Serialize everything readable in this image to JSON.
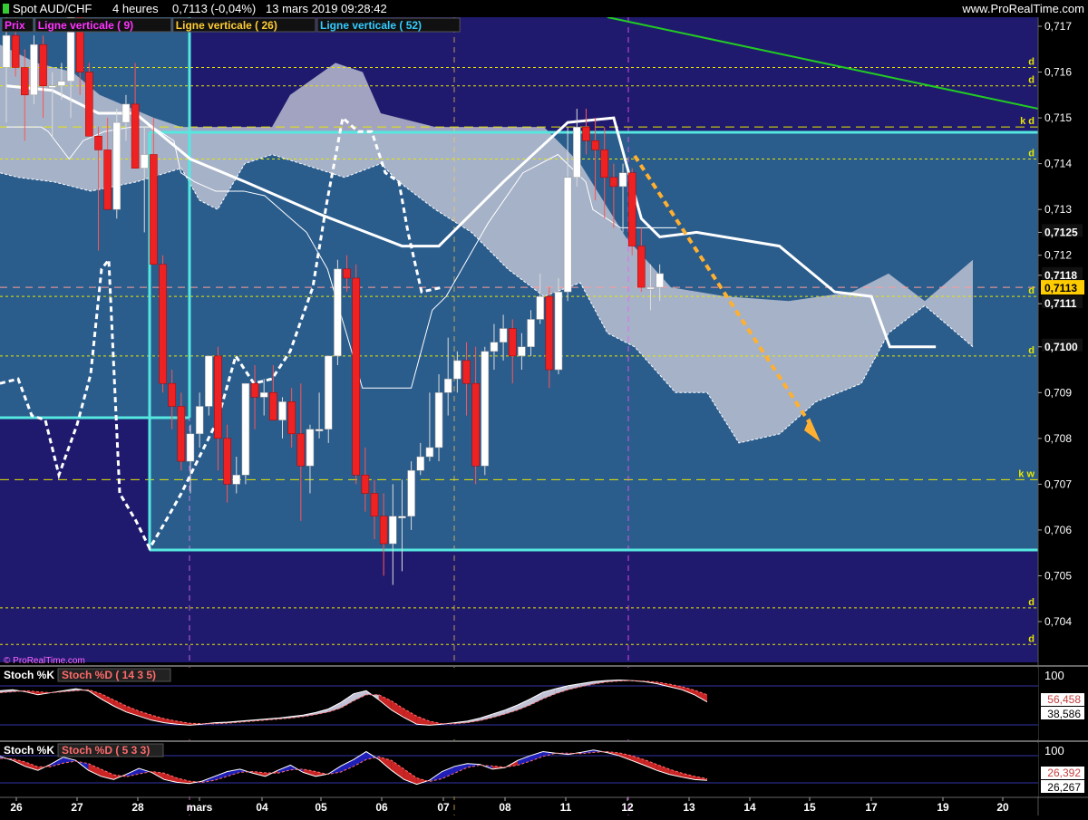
{
  "header": {
    "instrument": "Spot AUD/CHF",
    "timeframe": "4 heures",
    "last": "0,7113 (-0,04%)",
    "datetime": "13 mars 2019 09:28:42",
    "site": "www.ProRealTime.com",
    "watermark": "© ProRealTime.com"
  },
  "legend": [
    {
      "label": "Prix",
      "color": "#ff33ff"
    },
    {
      "label": "Ligne verticale ( 9)",
      "color": "#ff33ff"
    },
    {
      "label": "Ligne verticale ( 26)",
      "color": "#ffcc33"
    },
    {
      "label": "Ligne verticale ( 52)",
      "color": "#33ccff"
    }
  ],
  "stoch1": {
    "label_k": "Stoch %K",
    "label_d": "Stoch %D ( 14 3 5)",
    "top": "100",
    "val_d": "56,458",
    "val_k": "38,586"
  },
  "stoch2": {
    "label_k": "Stoch %K",
    "label_d": "Stoch %D ( 5 3 3)",
    "top": "100",
    "val_d": "26,392",
    "val_k": "26,267"
  },
  "colors": {
    "bg_main": "#1f1a6e",
    "bg_zone": "#2a5c8c",
    "bull": "#ffffff",
    "bear": "#ee2222",
    "cyan": "#55e8e0",
    "kijun": "#ffffff",
    "trend": "#22cc22",
    "arrow": "#ffb030",
    "yellow": "#e6e600"
  },
  "chart_data": [
    {
      "type": "candlestick",
      "title": "Spot AUD/CHF 4 heures",
      "ylim": [
        0.7033,
        0.7172
      ],
      "x_ticks": [
        "26",
        "27",
        "28",
        "mars",
        "04",
        "05",
        "06",
        "07",
        "08",
        "11",
        "12",
        "13",
        "14",
        "15",
        "17",
        "19",
        "20"
      ],
      "y_ticks": [
        "0,717",
        "0,716",
        "0,715",
        "0,714",
        "0,713",
        "0,7125",
        "0,712",
        "0,7118",
        "0,7111",
        "0,7100",
        "0,709",
        "0,708",
        "0,707",
        "0,706",
        "0,705",
        "0,704"
      ],
      "last_price": "0,7113",
      "level_marks": [
        {
          "y": 0.7161,
          "label": "d"
        },
        {
          "y": 0.7157,
          "label": "d"
        },
        {
          "y": 0.7148,
          "label": "k d"
        },
        {
          "y": 0.7141,
          "label": "d"
        },
        {
          "y": 0.7111,
          "label": "d"
        },
        {
          "y": 0.7098,
          "label": "d"
        },
        {
          "y": 0.7071,
          "label": "k w"
        },
        {
          "y": 0.7043,
          "label": "d"
        },
        {
          "y": 0.7035,
          "label": "d"
        }
      ],
      "candles": [
        [
          0.7161,
          0.7173,
          0.7149,
          0.7168
        ],
        [
          0.7168,
          0.7172,
          0.7159,
          0.7161
        ],
        [
          0.7161,
          0.7165,
          0.7145,
          0.7155
        ],
        [
          0.7155,
          0.7168,
          0.7153,
          0.7166
        ],
        [
          0.7166,
          0.7168,
          0.715,
          0.7157
        ],
        [
          0.7157,
          0.716,
          0.7146,
          0.7157
        ],
        [
          0.7157,
          0.7162,
          0.7154,
          0.7158
        ],
        [
          0.7158,
          0.7172,
          0.715,
          0.7172
        ],
        [
          0.7172,
          0.7175,
          0.7155,
          0.716
        ],
        [
          0.716,
          0.7162,
          0.7148,
          0.7146
        ],
        [
          0.7146,
          0.7148,
          0.7121,
          0.7143
        ],
        [
          0.7143,
          0.715,
          0.713,
          0.713
        ],
        [
          0.713,
          0.7152,
          0.7128,
          0.7149
        ],
        [
          0.7149,
          0.7155,
          0.7145,
          0.7153
        ],
        [
          0.7153,
          0.7162,
          0.714,
          0.7139
        ],
        [
          0.7139,
          0.7148,
          0.7125,
          0.7142
        ],
        [
          0.7142,
          0.715,
          0.712,
          0.7118
        ],
        [
          0.7118,
          0.712,
          0.709,
          0.7092
        ],
        [
          0.7092,
          0.7095,
          0.7082,
          0.7087
        ],
        [
          0.7087,
          0.709,
          0.7073,
          0.7075
        ],
        [
          0.7075,
          0.7083,
          0.7068,
          0.7081
        ],
        [
          0.7081,
          0.709,
          0.7078,
          0.7087
        ],
        [
          0.7087,
          0.7098,
          0.7085,
          0.7098
        ],
        [
          0.7098,
          0.71,
          0.7073,
          0.708
        ],
        [
          0.708,
          0.7083,
          0.7066,
          0.707
        ],
        [
          0.707,
          0.7076,
          0.7068,
          0.7072
        ],
        [
          0.7072,
          0.7092,
          0.707,
          0.7092
        ],
        [
          0.7092,
          0.7096,
          0.7082,
          0.7089
        ],
        [
          0.7089,
          0.7093,
          0.7085,
          0.709
        ],
        [
          0.709,
          0.7096,
          0.7085,
          0.7084
        ],
        [
          0.7084,
          0.7089,
          0.708,
          0.7088
        ],
        [
          0.7088,
          0.7091,
          0.7078,
          0.7081
        ],
        [
          0.7081,
          0.7092,
          0.7062,
          0.7074
        ],
        [
          0.7074,
          0.7083,
          0.7068,
          0.7082
        ],
        [
          0.7082,
          0.709,
          0.708,
          0.7082
        ],
        [
          0.7082,
          0.7098,
          0.7079,
          0.7098
        ],
        [
          0.7098,
          0.7119,
          0.7096,
          0.7117
        ],
        [
          0.7117,
          0.712,
          0.7112,
          0.7115
        ],
        [
          0.7115,
          0.7118,
          0.707,
          0.7072
        ],
        [
          0.7072,
          0.7078,
          0.7064,
          0.7068
        ],
        [
          0.7068,
          0.7071,
          0.7058,
          0.7063
        ],
        [
          0.7063,
          0.7068,
          0.705,
          0.7057
        ],
        [
          0.7057,
          0.707,
          0.7048,
          0.7063
        ],
        [
          0.7063,
          0.7071,
          0.7051,
          0.7063
        ],
        [
          0.7063,
          0.7075,
          0.706,
          0.7073
        ],
        [
          0.7073,
          0.7079,
          0.7072,
          0.7076
        ],
        [
          0.7076,
          0.709,
          0.7075,
          0.7078
        ],
        [
          0.7078,
          0.7094,
          0.7075,
          0.709
        ],
        [
          0.709,
          0.7102,
          0.7085,
          0.7093
        ],
        [
          0.7093,
          0.7099,
          0.709,
          0.7097
        ],
        [
          0.7097,
          0.7101,
          0.7085,
          0.7092
        ],
        [
          0.7092,
          0.71,
          0.707,
          0.7074
        ],
        [
          0.7074,
          0.71,
          0.7072,
          0.7099
        ],
        [
          0.7099,
          0.7105,
          0.7095,
          0.7101
        ],
        [
          0.7101,
          0.7107,
          0.7097,
          0.7104
        ],
        [
          0.7104,
          0.7106,
          0.7092,
          0.7098
        ],
        [
          0.7098,
          0.7103,
          0.7095,
          0.71
        ],
        [
          0.71,
          0.7108,
          0.7098,
          0.7106
        ],
        [
          0.7106,
          0.7116,
          0.7105,
          0.7111
        ],
        [
          0.7111,
          0.7113,
          0.7091,
          0.7095
        ],
        [
          0.7095,
          0.7115,
          0.7094,
          0.7112
        ],
        [
          0.7112,
          0.7148,
          0.711,
          0.7137
        ],
        [
          0.7137,
          0.7152,
          0.7135,
          0.7148
        ],
        [
          0.7148,
          0.7152,
          0.7142,
          0.7145
        ],
        [
          0.7145,
          0.715,
          0.7132,
          0.7143
        ],
        [
          0.7143,
          0.7148,
          0.7128,
          0.7137
        ],
        [
          0.7137,
          0.714,
          0.7126,
          0.7135
        ],
        [
          0.7135,
          0.714,
          0.7125,
          0.7138
        ],
        [
          0.7138,
          0.7139,
          0.712,
          0.7122
        ],
        [
          0.7122,
          0.7126,
          0.7112,
          0.7113
        ],
        [
          0.7113,
          0.7118,
          0.7108,
          0.7113
        ],
        [
          0.7113,
          0.7118,
          0.711,
          0.7116
        ]
      ],
      "kijun": [
        0.7148,
        0.7148,
        0.7148,
        0.7148,
        0.7148,
        0.7148,
        0.7148,
        0.7148,
        0.7148,
        0.7148,
        0.7148,
        0.7148,
        0.7148,
        0.7148,
        0.7148,
        0.7148,
        0.7148,
        0.7148,
        0.7148,
        0.7148,
        0.7148,
        0.7148,
        0.7148,
        0.7148,
        0.7148,
        0.7148,
        0.7148,
        0.7148,
        0.7148,
        0.7148,
        0.7148,
        0.7148,
        0.7148,
        0.7148,
        0.7148,
        0.7148,
        0.7148,
        0.7148,
        0.7148,
        0.7148,
        0.7148,
        0.7148,
        0.7148,
        0.7148,
        0.7148,
        0.7148,
        0.7148,
        0.7148,
        0.7148,
        0.7148,
        0.7148,
        0.7148,
        0.7148,
        0.7148,
        0.7148,
        0.7148,
        0.7148,
        0.7148,
        0.7148,
        0.7148,
        0.7148,
        0.7148,
        0.7148,
        0.7148,
        0.7148,
        0.7148,
        0.7148,
        0.7148,
        0.7148,
        0.7148,
        0.7148,
        0.7148
      ],
      "tenkan_path": [
        [
          0.7148,
          0
        ],
        [
          0.7148,
          2
        ],
        [
          0.7148,
          5
        ],
        [
          0.7147,
          6
        ],
        [
          0.7141,
          9
        ],
        [
          0.7145,
          11
        ],
        [
          0.7147,
          14
        ],
        [
          0.7148,
          18
        ],
        [
          0.7148,
          21
        ],
        [
          0.7145,
          24
        ],
        [
          0.7138,
          25
        ],
        [
          0.7136,
          27
        ],
        [
          0.7134,
          30
        ],
        [
          0.7134,
          34
        ],
        [
          0.7133,
          37
        ],
        [
          0.7129,
          40
        ],
        [
          0.7125,
          43
        ],
        [
          0.7117,
          46
        ],
        [
          0.7091,
          51
        ],
        [
          0.7091,
          58
        ],
        [
          0.7108,
          61
        ],
        [
          0.7111,
          63
        ],
        [
          0.7127,
          69
        ],
        [
          0.7138,
          74
        ],
        [
          0.7142,
          79
        ],
        [
          0.7136,
          83
        ],
        [
          0.713,
          84
        ],
        [
          0.7126,
          88
        ],
        [
          0.7126,
          96
        ]
      ],
      "kijun_path": [
        [
          0.7157,
          0
        ],
        [
          0.7156,
          5
        ],
        [
          0.7151,
          10
        ],
        [
          0.7151,
          14
        ],
        [
          0.7141,
          20
        ],
        [
          0.7136,
          26
        ],
        [
          0.7129,
          34
        ],
        [
          0.7122,
          43
        ],
        [
          0.7122,
          47
        ],
        [
          0.7136,
          54
        ],
        [
          0.7149,
          61
        ],
        [
          0.715,
          66
        ],
        [
          0.7128,
          69
        ],
        [
          0.7124,
          71
        ],
        [
          0.7125,
          75
        ],
        [
          0.7122,
          84
        ],
        [
          0.7112,
          90
        ],
        [
          0.7111,
          94
        ],
        [
          0.71,
          96
        ],
        [
          0.71,
          101
        ]
      ]
    },
    {
      "type": "area",
      "title": "Stoch %K / Stoch %D ( 14 3 5)",
      "ylim": [
        0,
        100
      ],
      "y_ticks": [
        "100"
      ],
      "series": [
        {
          "name": "Stoch %K",
          "values": [
            78,
            80,
            76,
            70,
            74,
            78,
            82,
            78,
            62,
            48,
            36,
            28,
            20,
            15,
            12,
            10,
            12,
            15,
            16,
            18,
            20,
            22,
            24,
            27,
            30,
            35,
            42,
            55,
            72,
            78,
            60,
            40,
            25,
            12,
            10,
            12,
            15,
            18,
            24,
            32,
            40,
            50,
            62,
            75,
            82,
            88,
            92,
            96,
            98,
            99,
            98,
            96,
            92,
            86,
            80,
            70,
            56
          ]
        },
        {
          "name": "Stoch %D ( 14 3 5)",
          "values": [
            74,
            76,
            78,
            76,
            74,
            76,
            78,
            80,
            72,
            60,
            48,
            38,
            30,
            23,
            18,
            14,
            13,
            13,
            14,
            16,
            18,
            20,
            22,
            24,
            27,
            31,
            36,
            44,
            58,
            70,
            70,
            58,
            42,
            28,
            18,
            13,
            13,
            15,
            19,
            25,
            32,
            40,
            50,
            62,
            72,
            80,
            86,
            91,
            95,
            97,
            98,
            97,
            95,
            91,
            86,
            79,
            70
          ]
        }
      ]
    },
    {
      "type": "area",
      "title": "Stoch %K / Stoch %D ( 5 3 3)",
      "ylim": [
        0,
        100
      ],
      "y_ticks": [
        "100"
      ],
      "series": [
        {
          "name": "Stoch %K",
          "values": [
            80,
            70,
            55,
            45,
            60,
            78,
            70,
            45,
            30,
            22,
            35,
            50,
            40,
            22,
            15,
            12,
            18,
            30,
            42,
            48,
            38,
            30,
            45,
            58,
            40,
            30,
            36,
            56,
            72,
            92,
            72,
            45,
            22,
            10,
            20,
            42,
            55,
            62,
            60,
            48,
            52,
            70,
            82,
            92,
            88,
            85,
            90,
            96,
            90,
            82,
            70,
            58,
            45,
            35,
            28,
            22,
            20
          ]
        },
        {
          "name": "Stoch %D ( 5 3 3)",
          "values": [
            75,
            74,
            66,
            54,
            54,
            63,
            68,
            62,
            48,
            34,
            29,
            36,
            42,
            38,
            26,
            18,
            15,
            20,
            30,
            40,
            42,
            39,
            38,
            46,
            48,
            42,
            35,
            41,
            55,
            72,
            79,
            70,
            48,
            26,
            17,
            24,
            38,
            52,
            58,
            56,
            53,
            58,
            68,
            80,
            88,
            88,
            87,
            90,
            92,
            89,
            82,
            72,
            60,
            48,
            38,
            30,
            24
          ]
        }
      ]
    }
  ]
}
